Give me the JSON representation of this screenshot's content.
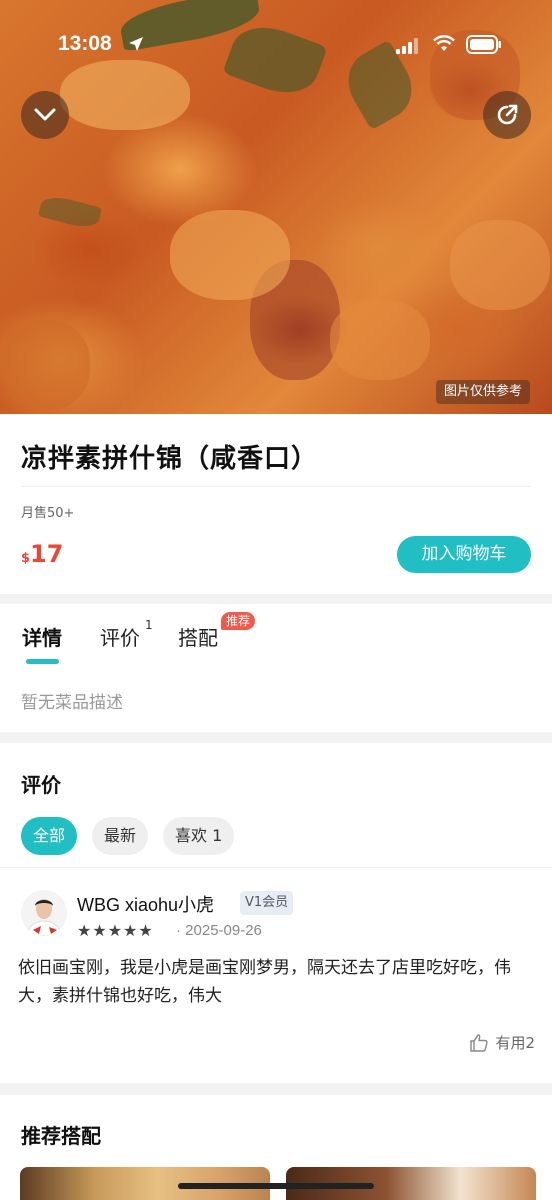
{
  "status_bar": {
    "time": "13:08"
  },
  "hero": {
    "image_note": "图片仅供参考"
  },
  "product": {
    "title": "凉拌素拼什锦（咸香口）",
    "monthly_sales": "月售50+",
    "currency": "$",
    "price": "17",
    "add_to_cart_label": "加入购物车"
  },
  "tabs": {
    "items": [
      {
        "label": "详情"
      },
      {
        "label": "评价",
        "sup": "1"
      },
      {
        "label": "搭配",
        "badge": "推荐"
      }
    ],
    "active": "详情"
  },
  "details": {
    "empty_description": "暂无菜品描述"
  },
  "reviews": {
    "title": "评价",
    "filters": [
      {
        "label": "全部"
      },
      {
        "label": "最新"
      },
      {
        "label": "喜欢 1"
      }
    ],
    "active_filter": "全部",
    "items": [
      {
        "user": "WBG xiaohu小虎",
        "badge": "V1会员",
        "rating": 5,
        "stars": "★★★★★",
        "date": "· 2025-09-26",
        "text": "依旧画宝刚，我是小虎是画宝刚梦男，隔天还去了店里吃好吃，伟大，素拼什锦也好吃，伟大",
        "helpful_label": "有用2"
      }
    ]
  },
  "recommend": {
    "title": "推荐搭配"
  },
  "colors": {
    "accent": "#21bfc4",
    "price": "#e8473a",
    "badge_red": "#ee5b4c"
  },
  "icons": {
    "back": "chevron-down-icon",
    "share": "share-icon",
    "helpful": "thumbs-up-icon",
    "location": "location-arrow-icon",
    "signal": "signal-icon",
    "wifi": "wifi-icon",
    "battery": "battery-icon"
  }
}
